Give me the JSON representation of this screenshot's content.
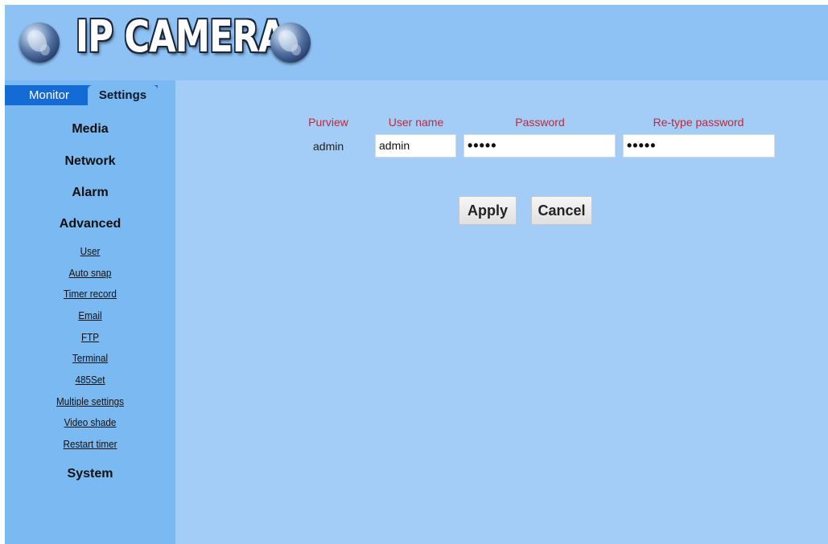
{
  "header": {
    "logo_text": "IP CAMERA"
  },
  "tabs": {
    "monitor": "Monitor",
    "settings": "Settings"
  },
  "sidebar": {
    "media": "Media",
    "network": "Network",
    "alarm": "Alarm",
    "advanced": "Advanced",
    "links": [
      "User",
      "Auto snap",
      "Timer record",
      "Email",
      "FTP",
      "Terminal",
      "485Set",
      "Multiple settings",
      "Video shade",
      "Restart timer"
    ],
    "system": "System"
  },
  "form": {
    "columns": {
      "purview": "Purview",
      "user_name": "User name",
      "password": "Password",
      "retype": "Re-type password"
    },
    "row": {
      "purview": "admin",
      "user_name": "admin",
      "password": "•••••",
      "retype": "•••••"
    }
  },
  "buttons": {
    "apply": "Apply",
    "cancel": "Cancel"
  },
  "colors": {
    "header_bg": "#8ec2f4",
    "sidebar_bg": "#7ab9f1",
    "content_bg": "#a3cdf7",
    "tab_bar": "#156bd6",
    "column_header": "#c0283a"
  }
}
